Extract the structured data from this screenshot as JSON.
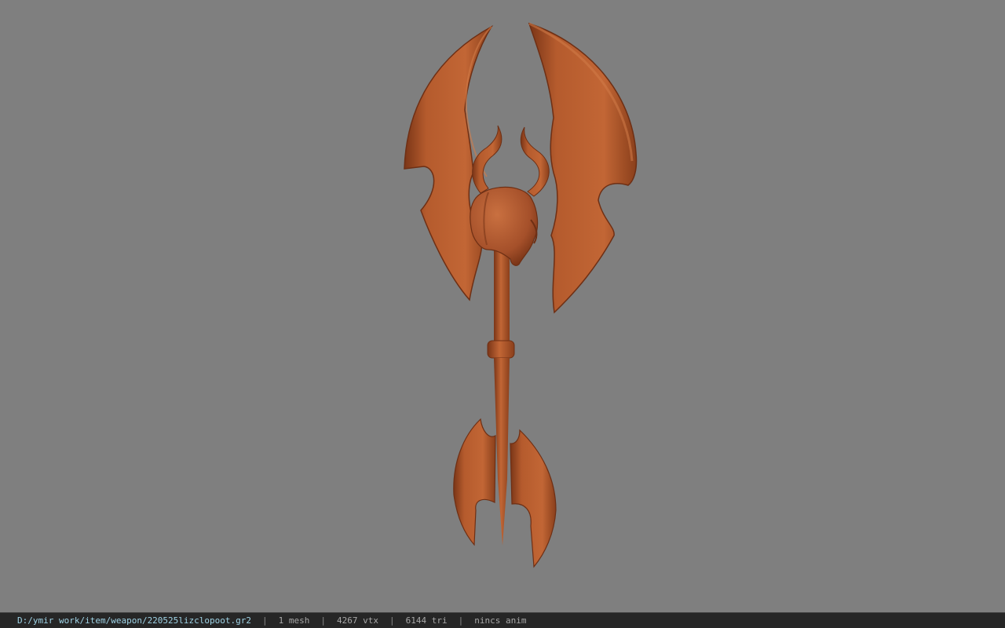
{
  "status": {
    "file_path": "D:/ymir work/item/weapon/220525lizclopoot.gr2",
    "separator": "|",
    "mesh_count": "1 mesh",
    "vertex_count": "4267 vtx",
    "triangle_count": "6144 tri",
    "anim": "nincs anim"
  },
  "colors": {
    "background": "#7f7f7f",
    "model_base": "#b0582c",
    "model_light": "#c56a38",
    "model_shadow": "#7a3517",
    "statusbar_bg": "#262626",
    "path_text": "#9fd3e6"
  },
  "icons": {
    "model": "battle-axe-model"
  }
}
